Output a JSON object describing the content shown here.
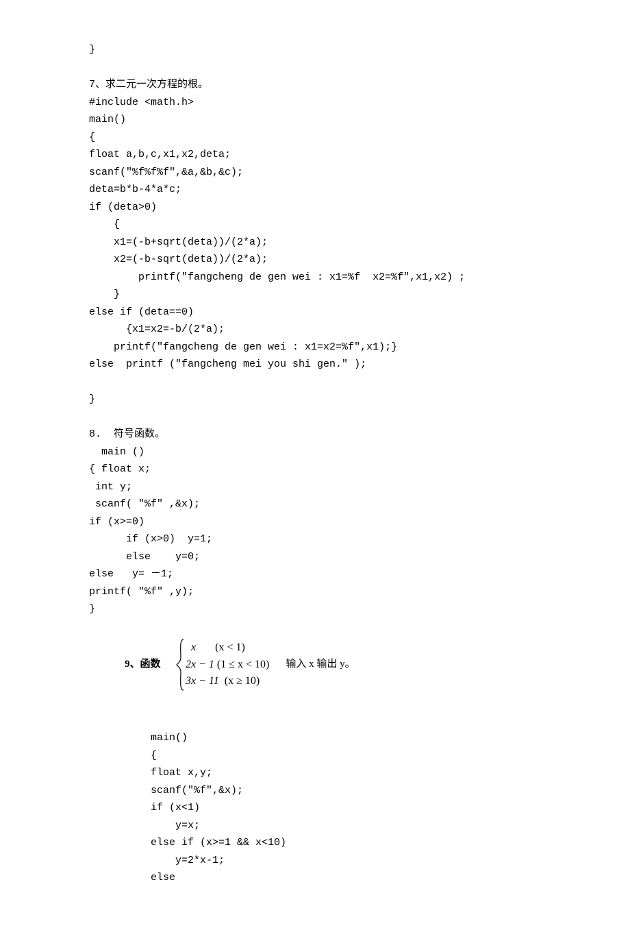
{
  "lines_top": [
    "}",
    "",
    "7、求二元一次方程的根。",
    "#include <math.h>",
    "main()",
    "{",
    "float a,b,c,x1,x2,deta;",
    "scanf(\"%f%f%f\",&a,&b,&c);",
    "deta=b*b-4*a*c;",
    "if (deta>0)",
    "    {",
    "    x1=(-b+sqrt(deta))/(2*a);",
    "    x2=(-b-sqrt(deta))/(2*a);",
    "        printf(\"fangcheng de gen wei : x1=%f  x2=%f\",x1,x2) ;",
    "    }",
    "else if (deta==0)",
    "      {x1=x2=-b/(2*a);",
    "    printf(\"fangcheng de gen wei : x1=x2=%f\",x1);}",
    "else  printf (\"fangcheng mei you shi gen.\" );",
    "",
    "}",
    "",
    "8.  符号函数。",
    "  main ()",
    "{ float x;",
    " int y;",
    " scanf( \"%f\" ,&x);",
    "if (x>=0)",
    "      if (x>0)  y=1;",
    "      else    y=0;",
    "else   y= －1;",
    "printf( \"%f\" ,y);",
    "}",
    ""
  ],
  "func": {
    "label": "9、函数      ",
    "case1_expr": "  x",
    "case1_cond": "       (x < 1)",
    "case2_expr": "2x − 1",
    "case2_cond": " (1 ≤ x < 10)",
    "case3_expr": "3x − 11",
    "case3_cond": "  (x ≥ 10)",
    "tail": "输入 x 输出 y。"
  },
  "lines_bottom": [
    "",
    "",
    "          main()",
    "          {",
    "          float x,y;",
    "          scanf(\"%f\",&x);",
    "          if (x<1)",
    "              y=x;",
    "          else if (x>=1 && x<10)",
    "              y=2*x-1;",
    "          else"
  ]
}
